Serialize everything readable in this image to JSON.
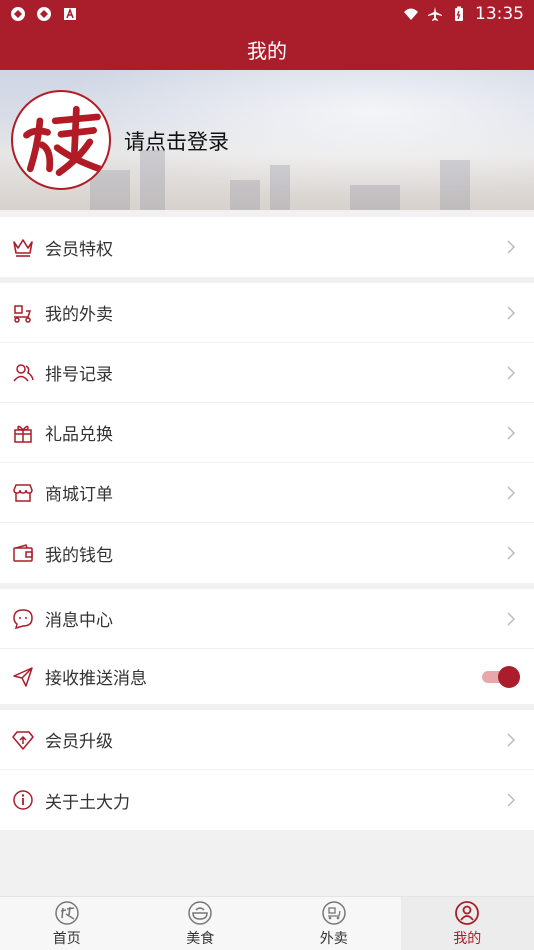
{
  "status_bar": {
    "time": "13:35"
  },
  "header": {
    "title": "我的"
  },
  "profile": {
    "login_prompt": "请点击登录",
    "avatar_glyph": "类"
  },
  "sections": {
    "membership": {
      "items": [
        {
          "label": "会员特权",
          "icon": "crown-icon"
        }
      ]
    },
    "services": {
      "items": [
        {
          "label": "我的外卖",
          "icon": "delivery-scooter-icon"
        },
        {
          "label": "排号记录",
          "icon": "users-icon"
        },
        {
          "label": "礼品兑换",
          "icon": "gift-icon"
        },
        {
          "label": "商城订单",
          "icon": "store-icon"
        },
        {
          "label": "我的钱包",
          "icon": "wallet-icon"
        }
      ]
    },
    "messages": {
      "items": [
        {
          "label": "消息中心",
          "icon": "message-icon"
        },
        {
          "label": "接收推送消息",
          "icon": "paper-plane-icon",
          "toggle_on": true
        }
      ]
    },
    "about": {
      "items": [
        {
          "label": "会员升级",
          "icon": "diamond-upgrade-icon"
        },
        {
          "label": "关于土大力",
          "icon": "info-icon"
        }
      ]
    }
  },
  "tab_bar": {
    "tabs": [
      {
        "label": "首页",
        "icon": "home-logo-icon",
        "active": false
      },
      {
        "label": "美食",
        "icon": "food-bowl-icon",
        "active": false
      },
      {
        "label": "外卖",
        "icon": "takeout-icon",
        "active": false
      },
      {
        "label": "我的",
        "icon": "profile-icon",
        "active": true
      }
    ]
  },
  "colors": {
    "brand": "#a91e2a",
    "toggle_track": "#e7a7ab"
  }
}
